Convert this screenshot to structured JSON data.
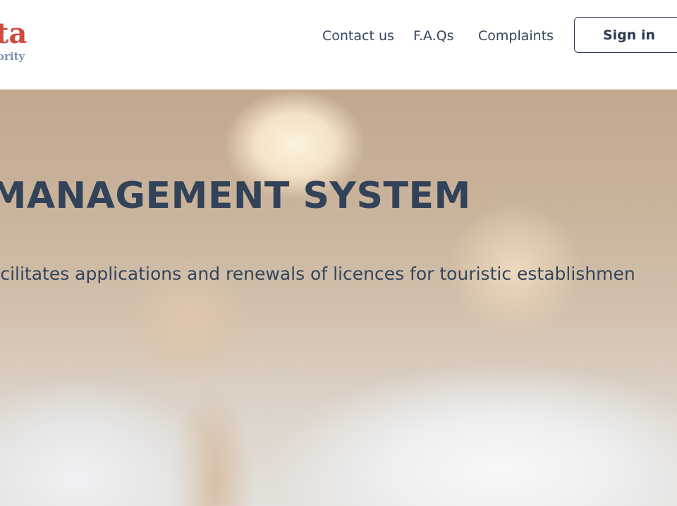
{
  "header": {
    "logo": {
      "main": "ta",
      "sub": "ority"
    },
    "nav": {
      "contact_label": "Contact us",
      "faq_label": "F.A.Qs",
      "complaints_label": "Complaints"
    },
    "signin_label": "Sign in"
  },
  "hero": {
    "title": "E MANAGEMENT SYSTEM",
    "subtitle": "acilitates applications and renewals of licences for touristic establishmen"
  },
  "colors": {
    "logo_red": "#cf4a40",
    "logo_blue": "#7a91b3",
    "text_navy": "#33475f",
    "button_border": "#2f3e55"
  }
}
